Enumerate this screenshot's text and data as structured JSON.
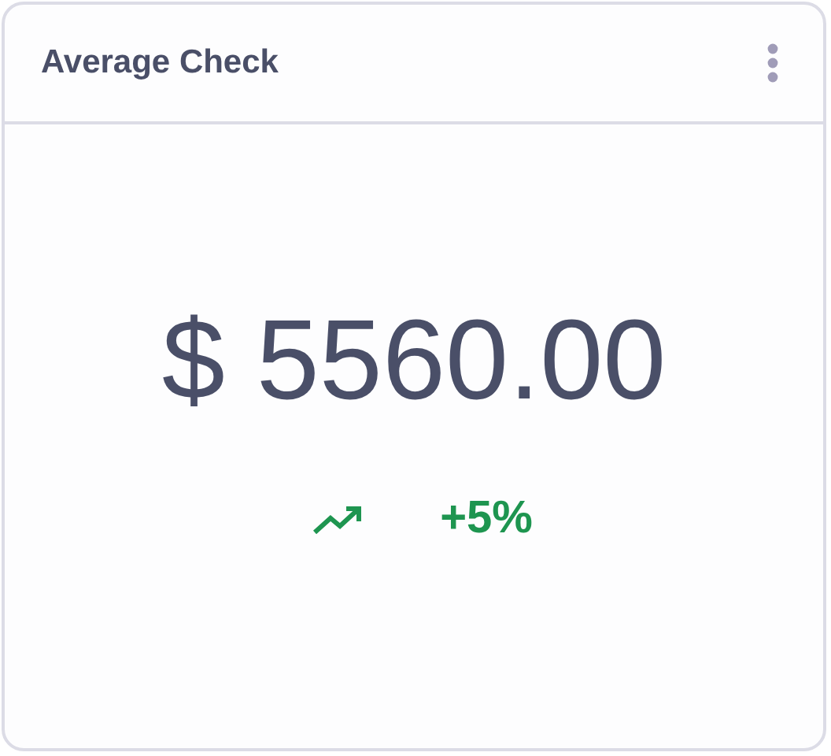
{
  "card": {
    "title": "Average Check",
    "value": "$ 5560.00",
    "change": {
      "rising": true,
      "text": "+5%"
    }
  }
}
